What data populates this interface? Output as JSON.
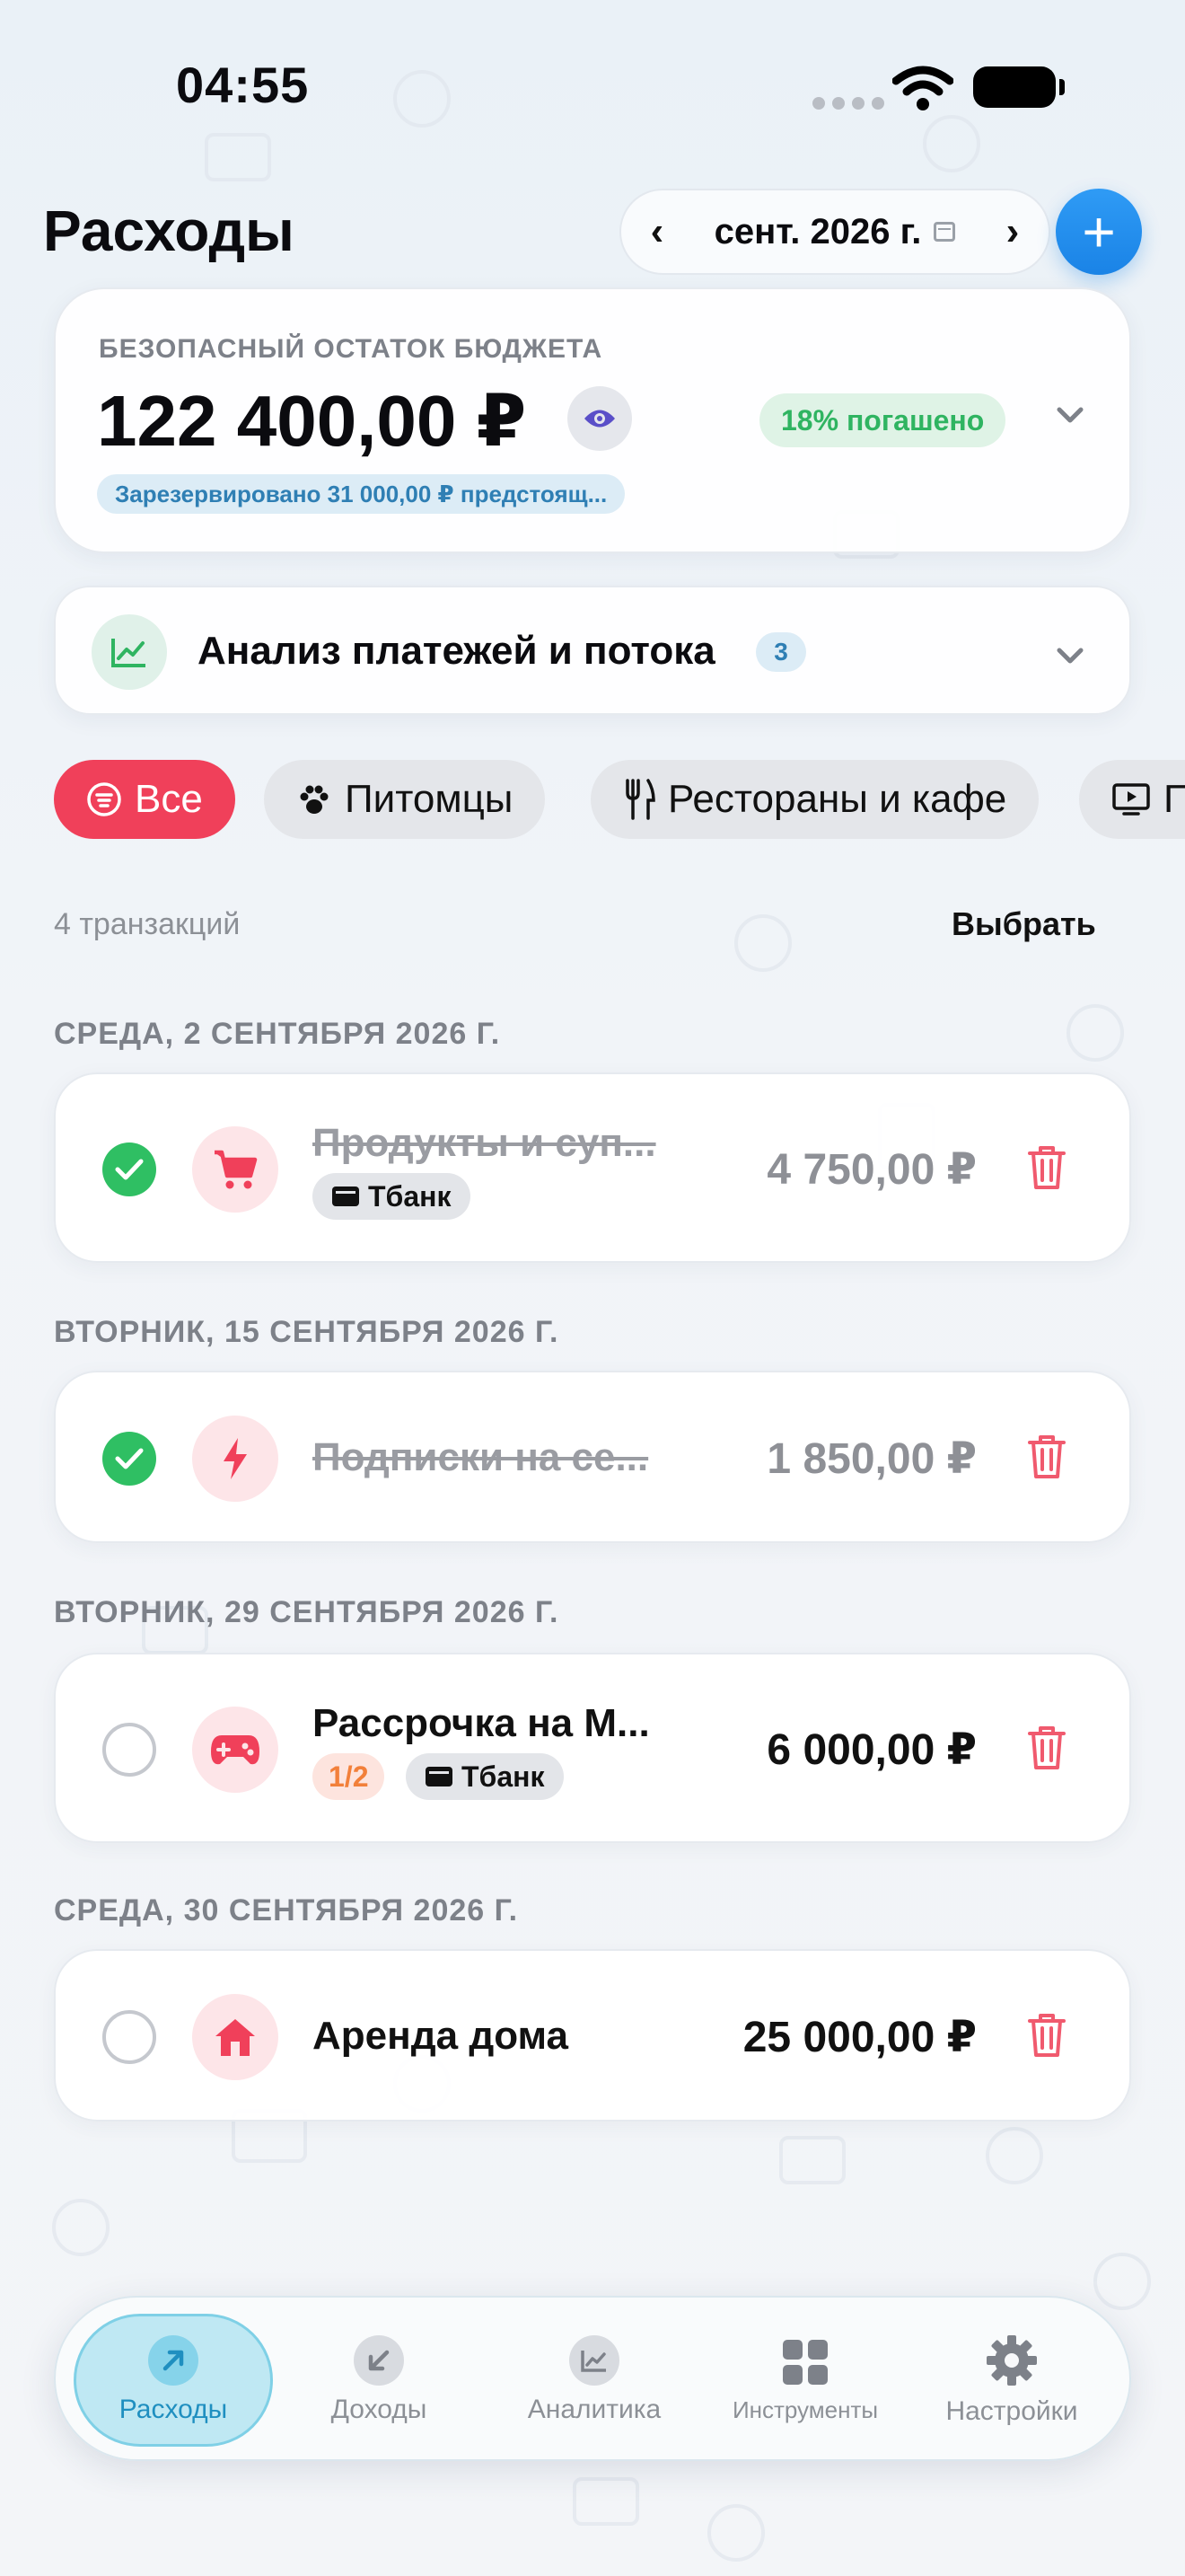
{
  "status_bar": {
    "time": "04:55"
  },
  "header": {
    "title": "Расходы",
    "month_label": "сент. 2026 г.",
    "prev_icon": "chevron-left-icon",
    "next_icon": "chevron-right-icon",
    "add_icon": "plus-icon"
  },
  "budget": {
    "caption": "БЕЗОПАСНЫЙ ОСТАТОК БЮДЖЕТА",
    "amount": "122 400,00 ₽",
    "paid_badge": "18% погашено",
    "reserved": "Зарезервировано 31 000,00 ₽ предстоящ..."
  },
  "analysis": {
    "label": "Анализ платежей и потока",
    "count": "3"
  },
  "filters": [
    {
      "label": "Все",
      "icon": "list-icon",
      "active": true
    },
    {
      "label": "Питомцы",
      "icon": "paw-icon",
      "active": false
    },
    {
      "label": "Рестораны и кафе",
      "icon": "fork-knife-icon",
      "active": false
    },
    {
      "label": "П",
      "icon": "tv-icon",
      "active": false
    }
  ],
  "list": {
    "count_label": "4 транзакций",
    "select_label": "Выбрать"
  },
  "days": [
    {
      "header": "СРЕДА, 2 СЕНТЯБРЯ 2026 Г.",
      "tx": {
        "name": "Продукты и суп...",
        "amount": "4 750,00 ₽",
        "account": "Тбанк",
        "done": true,
        "icon": "cart-icon"
      }
    },
    {
      "header": "ВТОРНИК, 15 СЕНТЯБРЯ 2026 Г.",
      "tx": {
        "name": "Подписки на се...",
        "amount": "1 850,00 ₽",
        "done": true,
        "icon": "bolt-icon"
      }
    },
    {
      "header": "ВТОРНИК, 29 СЕНТЯБРЯ 2026 Г.",
      "tx": {
        "name": "Рассрочка на М...",
        "amount": "6 000,00 ₽",
        "installment": "1/2",
        "account": "Тбанк",
        "done": false,
        "icon": "gamepad-icon"
      }
    },
    {
      "header": "СРЕДА, 30 СЕНТЯБРЯ 2026 Г.",
      "tx": {
        "name": "Аренда дома",
        "amount": "25 000,00 ₽",
        "done": false,
        "icon": "house-icon"
      }
    }
  ],
  "tabs": [
    {
      "label": "Расходы",
      "icon": "arrow-up-right-icon",
      "active": true
    },
    {
      "label": "Доходы",
      "icon": "arrow-down-left-icon",
      "active": false
    },
    {
      "label": "Аналитика",
      "icon": "chart-icon",
      "active": false
    },
    {
      "label": "Инструменты",
      "icon": "grid-icon",
      "active": false
    },
    {
      "label": "Настройки",
      "icon": "gear-icon",
      "active": false
    }
  ],
  "colors": {
    "accent_blue": "#1a83e6",
    "filter_active": "#f0405a",
    "done_green": "#2fbf63",
    "paid_green": "#2fb461",
    "trash_red": "#f05a6e"
  }
}
